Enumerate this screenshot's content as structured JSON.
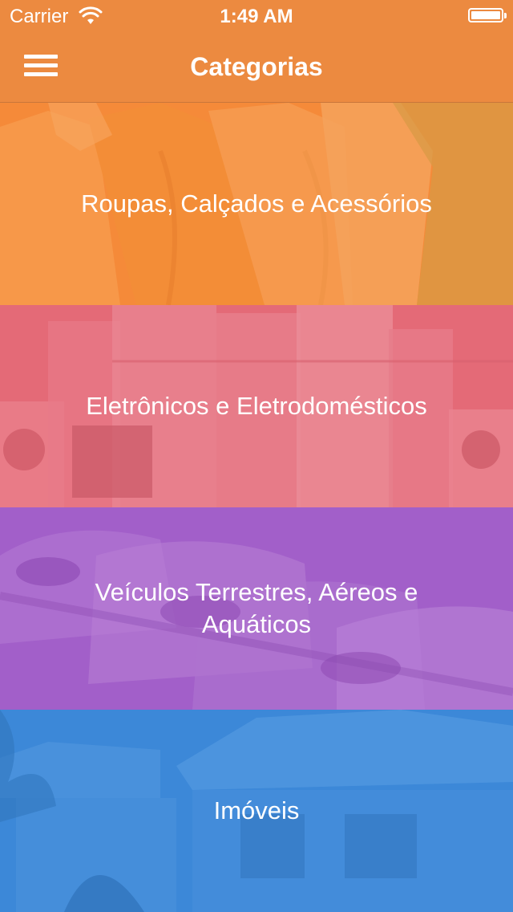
{
  "status_bar": {
    "carrier": "Carrier",
    "time": "1:49 AM",
    "icons": [
      "wifi-icon",
      "battery-icon"
    ]
  },
  "nav_bar": {
    "title": "Categorias",
    "menu_icon": "menu-icon"
  },
  "categories": [
    {
      "label": "Roupas, Calçados e Acessórios",
      "color": "#f58a3a",
      "image": "t-shirts"
    },
    {
      "label": "Eletrônicos e Eletrodomésticos",
      "color": "#e46a78",
      "image": "appliances"
    },
    {
      "label": "Veículos Terrestres, Aéreos e Aquáticos",
      "color": "#a25fc9",
      "image": "cars"
    },
    {
      "label": "Imóveis",
      "color": "#3d88d8",
      "image": "house"
    }
  ],
  "colors": {
    "accent": "#ec8a40"
  }
}
